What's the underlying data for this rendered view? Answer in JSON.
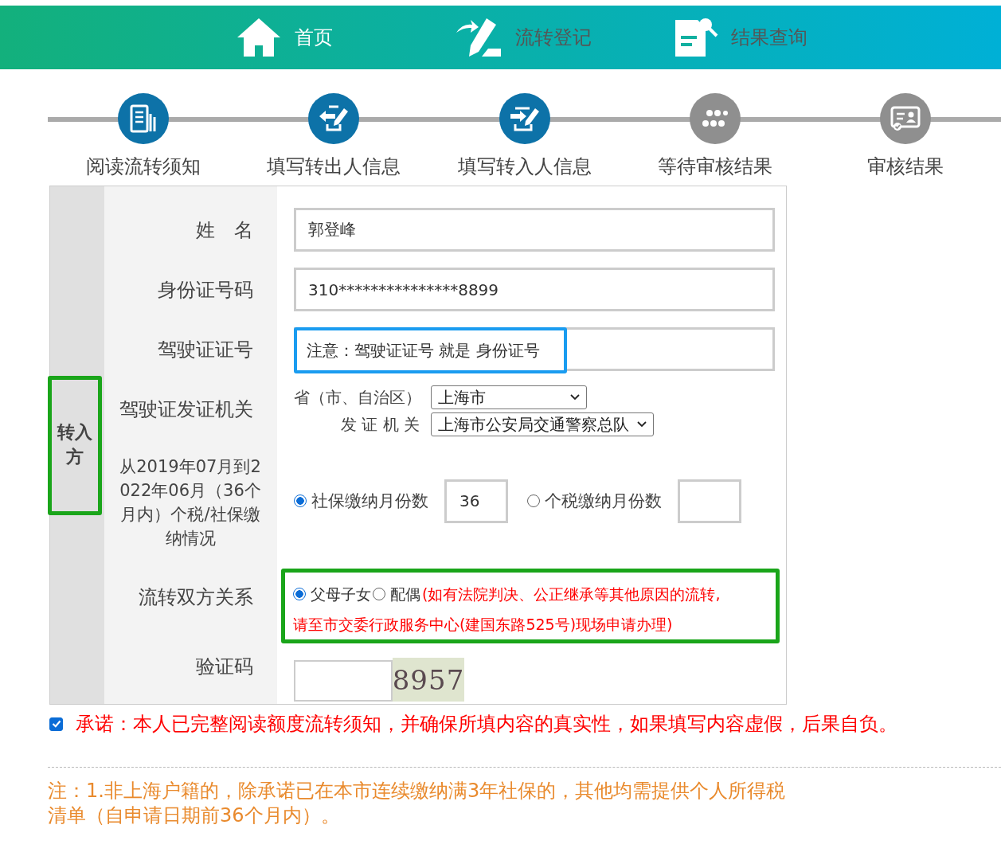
{
  "nav": [
    {
      "label": "首页",
      "selected": true
    },
    {
      "label": "流转登记",
      "selected": false
    },
    {
      "label": "结果查询",
      "selected": false
    }
  ],
  "steps": [
    {
      "label": "阅读流转须知",
      "done": true
    },
    {
      "label": "填写转出人信息",
      "done": true
    },
    {
      "label": "填写转入人信息",
      "done": true
    },
    {
      "label": "等待审核结果",
      "done": false
    },
    {
      "label": "审核结果",
      "done": false
    }
  ],
  "form": {
    "side_label": "转入方",
    "rows": [
      {
        "kind": "input",
        "label": "姓　名",
        "value": "郭登峰"
      },
      {
        "kind": "input",
        "label": "身份证号码",
        "value": "310***************8899"
      },
      {
        "kind": "hint",
        "label": "驾驶证证号",
        "hint": "注意：驾驶证证号 就是 身份证号"
      },
      {
        "kind": "selects",
        "label": "驾驶证发证机关",
        "selects": [
          {
            "label": "省（市、自治区）",
            "value": "上海市"
          },
          {
            "label": "发 证 机 关",
            "value": "上海市公安局交通警察总队"
          }
        ]
      },
      {
        "kind": "counts",
        "label": "从2019年07月到2022年06月（36个月内）个税/社保缴纳情况",
        "options": [
          {
            "label": "社保缴纳月份数",
            "selected": true,
            "value": "36"
          },
          {
            "label": "个税缴纳月份数",
            "selected": false
          }
        ]
      },
      {
        "kind": "relation",
        "label": "流转双方关系",
        "options": [
          {
            "label": "父母子女",
            "selected": true
          },
          {
            "label": "配偶",
            "selected": false
          }
        ],
        "note_lines": [
          "(如有法院判决、公正继承等其他原因的流转,",
          "请至市交委行政服务中心(建国东路525号)现场申请办理)"
        ]
      },
      {
        "kind": "captcha",
        "label": "验证码",
        "code": "8957"
      }
    ]
  },
  "pledge": {
    "checked": true,
    "text": "承诺：本人已完整阅读额度流转须知，并确保所填内容的真实性，如果填写内容虚假，后果自负。"
  },
  "footnote": "注：1.非上海户籍的，除承诺已在本市连续缴纳满3年社保的，其他均需提供个人所得税清单（自申请日期前36个月内）。"
}
